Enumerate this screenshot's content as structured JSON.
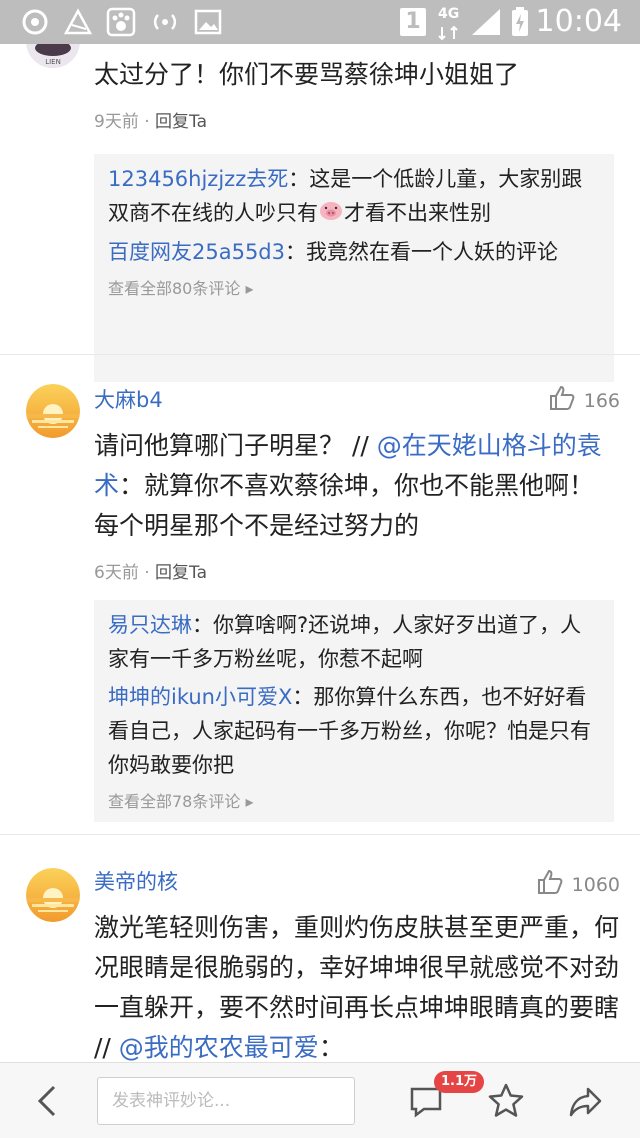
{
  "status_bar": {
    "time": "10:04",
    "sim_badge": "1",
    "network": "4G"
  },
  "comments": [
    {
      "text": "太过分了！你们不要骂蔡徐坤小姐姐了",
      "time": "9天前",
      "reply_label": "回复Ta",
      "replies": [
        {
          "name": "123456hjzjzz去死",
          "text": "：这是一个低龄儿童，大家别跟双商不在线的人吵只有",
          "text_after": "才看不出来性别"
        },
        {
          "name": "百度网友25a55d3",
          "text": "：我竟然在看一个人妖的评论"
        }
      ],
      "view_all": "查看全部80条评论"
    },
    {
      "username": "大麻b4",
      "likes": "166",
      "text_before": "请问他算哪门子明星？ // ",
      "mention": "@在天姥山格斗的袁术",
      "text_after": "：就算你不喜欢蔡徐坤，你也不能黑他啊！每个明星那个不是经过努力的",
      "time": "6天前",
      "reply_label": "回复Ta",
      "replies": [
        {
          "name": "易只达琳",
          "text": "：你算啥啊?还说坤，人家好歹出道了，人家有一千多万粉丝呢，你惹不起啊"
        },
        {
          "name": "坤坤的ikun小可爱X",
          "text": "：那你算什么东西，也不好好看看自己，人家起码有一千多万粉丝，你呢？怕是只有你妈敢要你把"
        }
      ],
      "view_all": "查看全部78条评论"
    },
    {
      "username": "美帝的核",
      "likes": "1060",
      "text_before": "激光笔轻则伤害，重则灼伤皮肤甚至更严重，何况眼睛是很脆弱的，幸好坤坤很早就感觉不对劲一直躲开，要不然时间再长点坤坤眼睛真的要瞎 // ",
      "mention": "@我的农农最可爱",
      "text_after": "："
    }
  ],
  "bottom_bar": {
    "input_placeholder": "发表神评妙论...",
    "comment_count": "1.1万"
  },
  "colors": {
    "link": "#3b6cc4",
    "badge": "#e64545",
    "status_bar": "#bdbdbd"
  }
}
